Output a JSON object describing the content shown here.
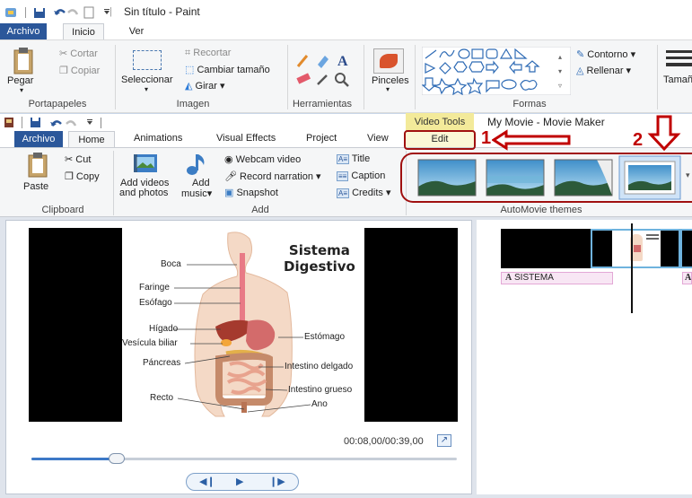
{
  "paint": {
    "title": "Sin título - Paint",
    "tabs": [
      {
        "label": "Archivo",
        "active": true
      },
      {
        "label": "Inicio"
      },
      {
        "label": "Ver"
      }
    ],
    "clipboard": {
      "paste": "Pegar",
      "cut": "Cortar",
      "copy": "Copiar",
      "group": "Portapapeles"
    },
    "image": {
      "select": "Seleccionar",
      "crop": "Recortar",
      "resize": "Cambiar tamaño",
      "rotate": "Girar",
      "group": "Imagen"
    },
    "tools": {
      "group": "Herramientas"
    },
    "brushes": {
      "label": "Pinceles"
    },
    "shapes": {
      "outline": "Contorno",
      "fill": "Rellenar",
      "group": "Formas"
    },
    "size": {
      "label": "Tamañ"
    }
  },
  "moviemaker": {
    "contextual_tab": "Video Tools",
    "title": "My Movie - Movie Maker",
    "tabs": [
      {
        "label": "Archivo",
        "active": true
      },
      {
        "label": "Home"
      },
      {
        "label": "Animations"
      },
      {
        "label": "Visual Effects"
      },
      {
        "label": "Project"
      },
      {
        "label": "View"
      },
      {
        "label": "Edit"
      }
    ],
    "clipboard": {
      "paste": "Paste",
      "cut": "Cut",
      "copy": "Copy",
      "group": "Clipboard"
    },
    "add": {
      "add_videos": "Add videos",
      "add_videos_2": "and photos",
      "add_music": "Add",
      "add_music_2": "music",
      "webcam": "Webcam video",
      "narration": "Record narration",
      "snapshot": "Snapshot",
      "title": "Title",
      "caption": "Caption",
      "credits": "Credits",
      "group": "Add"
    },
    "themes": {
      "group": "AutoMovie themes"
    },
    "annotations": {
      "step1": "1",
      "step2": "2"
    },
    "preview": {
      "heading_line1": "Sistema",
      "heading_line2": "Digestivo",
      "labels": [
        "Boca",
        "Faringe",
        "Esófago",
        "Hígado",
        "Vesícula biliar",
        "Páncreas",
        "Recto",
        "Estómago",
        "Intestino delgado",
        "Intestino grueso",
        "Ano"
      ],
      "time": "00:08,00/00:39,00",
      "progress_fraction": 0.2
    },
    "storyboard": {
      "caption_label": "SISTEMA",
      "caption_label_2": "A"
    }
  },
  "colors": {
    "accent_blue": "#2b579a",
    "annotation_red": "#c00000",
    "video_tools": "#f3ea9a"
  }
}
